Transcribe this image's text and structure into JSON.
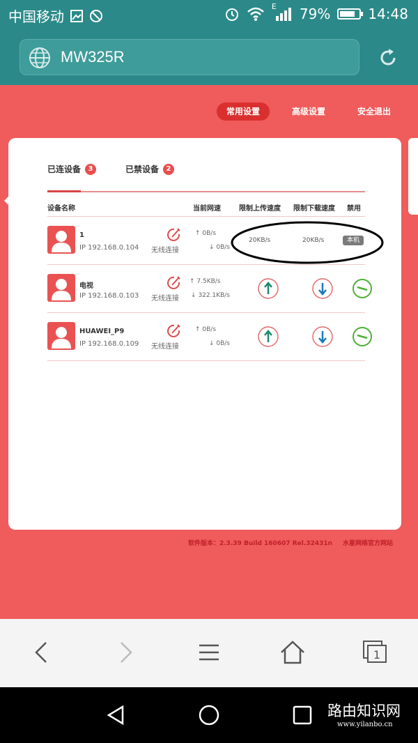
{
  "status_bar": {
    "carrier": "中国移动",
    "network_type": "E",
    "battery": "79%",
    "battery_level": 0.79,
    "time": "14:48"
  },
  "browser": {
    "url_text": "MW325R"
  },
  "top_nav": {
    "items": [
      {
        "label": "常用设置",
        "active": true
      },
      {
        "label": "高级设置",
        "active": false
      },
      {
        "label": "安全退出",
        "active": false
      }
    ]
  },
  "tabs": [
    {
      "label": "已连设备",
      "count": "3",
      "active": true
    },
    {
      "label": "已禁设备",
      "count": "2",
      "active": false
    }
  ],
  "table": {
    "headers": [
      "设备名称",
      "当前网速",
      "限制上传速度",
      "限制下载速度",
      "禁用"
    ],
    "rows": [
      {
        "name": "1",
        "ip": "IP 192.168.0.104",
        "connection": "无线连接",
        "up_speed": "0B/s",
        "down_speed": "0B/s",
        "up_limit": "20KB/s",
        "down_limit": "20KB/s",
        "ban": "本机"
      },
      {
        "name": "电视",
        "ip": "IP 192.168.0.103",
        "connection": "无线连接",
        "up_speed": "7.5KB/s",
        "down_speed": "322.1KB/s",
        "up_limit": "",
        "down_limit": "",
        "ban": ""
      },
      {
        "name": "HUAWEI_P9",
        "ip": "IP 192.168.0.109",
        "connection": "无线连接",
        "up_speed": "0B/s",
        "down_speed": "0B/s",
        "up_limit": "",
        "down_limit": "",
        "ban": ""
      }
    ]
  },
  "footer": {
    "version": "软件版本：2.3.39 Build 160607 Rel.32431n",
    "site_link": "水星网络官方网站"
  },
  "watermark": {
    "text": "路由知识网",
    "url": "www.yilanbo.cn"
  },
  "colors": {
    "teal": "#2b8a89",
    "page_red": "#f05b5b",
    "accent_red": "#d9302f",
    "up_arrow": "#1a8a6a",
    "down_arrow": "#1a7ab8",
    "ban_green": "#4cb035"
  }
}
